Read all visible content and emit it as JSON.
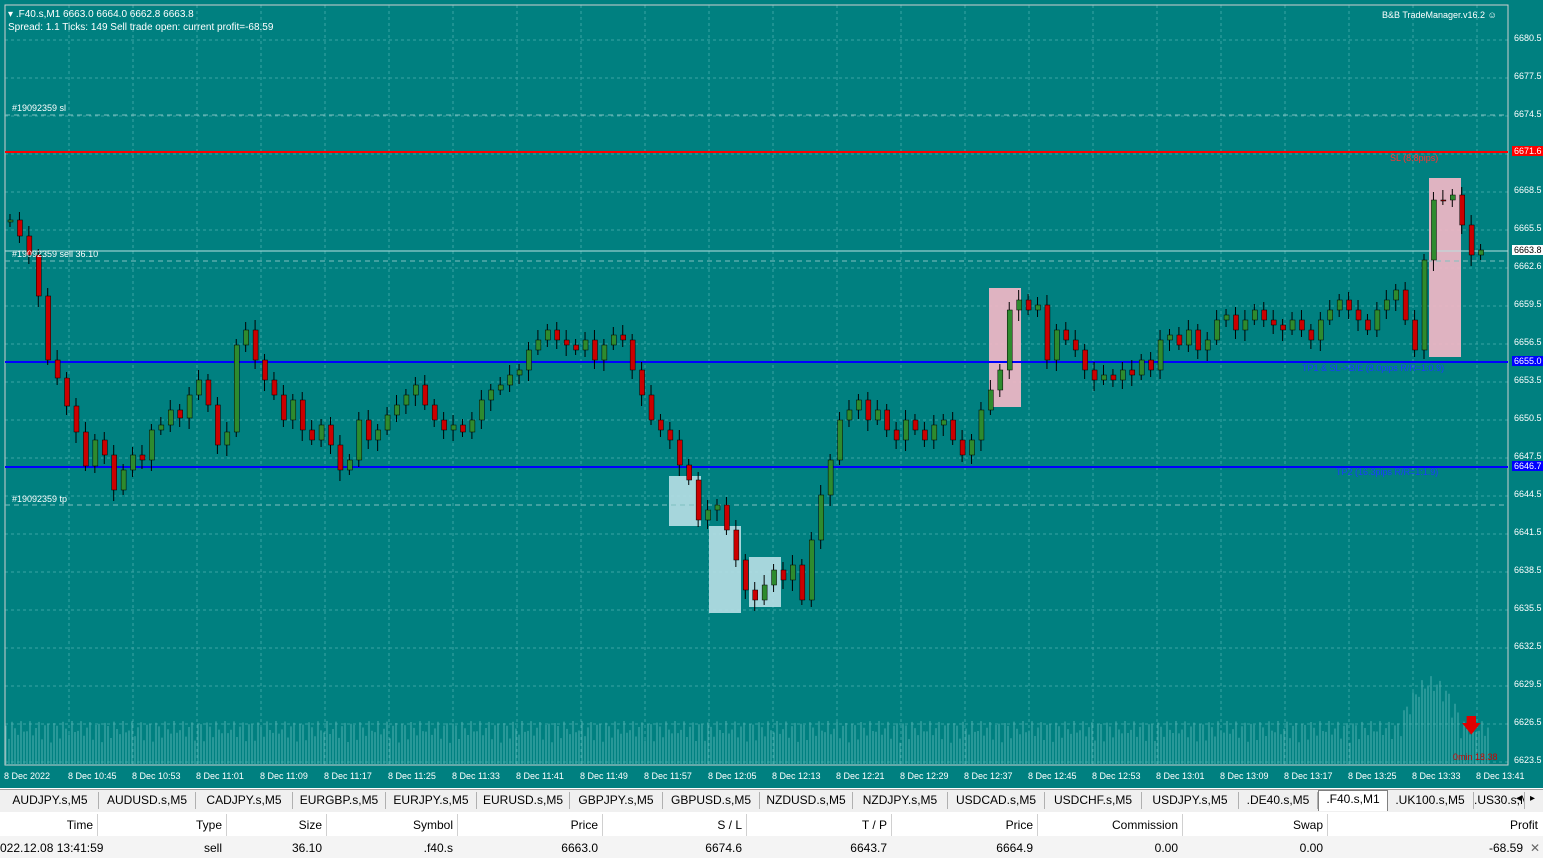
{
  "chart": {
    "header_line1": ".F40.s,M1  6663.0 6664.0 6662.8 6663.8",
    "header_line2": "Spread: 1.1   Ticks: 149   Sell trade open: current profit=-68.59",
    "indicator": "B&B TradeManager.v16.2",
    "lines": {
      "sl_label": "#19092359 sl",
      "entry_label": "#19092359 sell 36.10",
      "tp_label": "#19092359 tp",
      "sl_text": "SL (8.8pips)",
      "tp1_text": "TP1 & SL->B/E (8.0pips R/R=1:0.9)",
      "tp2_text": "TP2 (16.3pips R/R=1:1.9)",
      "timer": "0min 18.38"
    },
    "price_tags": {
      "sl": "6671.6",
      "current": "6663.8",
      "tp1": "6655.0",
      "tp2": "6646.7"
    },
    "price_axis": [
      "6680.5",
      "6677.5",
      "6674.5",
      "6671.5",
      "6668.5",
      "6665.5",
      "6662.6",
      "6659.5",
      "6656.5",
      "6653.5",
      "6650.5",
      "6647.5",
      "6644.5",
      "6641.5",
      "6638.5",
      "6635.5",
      "6632.5",
      "6629.5",
      "6626.5",
      "6623.5"
    ],
    "time_axis": [
      "8 Dec 2022",
      "8 Dec 10:45",
      "8 Dec 10:53",
      "8 Dec 11:01",
      "8 Dec 11:09",
      "8 Dec 11:17",
      "8 Dec 11:25",
      "8 Dec 11:33",
      "8 Dec 11:41",
      "8 Dec 11:49",
      "8 Dec 11:57",
      "8 Dec 12:05",
      "8 Dec 12:13",
      "8 Dec 12:21",
      "8 Dec 12:29",
      "8 Dec 12:37",
      "8 Dec 12:45",
      "8 Dec 12:53",
      "8 Dec 13:01",
      "8 Dec 13:09",
      "8 Dec 13:17",
      "8 Dec 13:25",
      "8 Dec 13:33",
      "8 Dec 13:41"
    ],
    "colors": {
      "background": "#008080",
      "bull": "#2e8b2e",
      "bear": "#cc0000",
      "sl_line": "#ff0000",
      "tp_line": "#0000ff"
    }
  },
  "tabs": [
    "AUDJPY.s,M5",
    "AUDUSD.s,M5",
    "CADJPY.s,M5",
    "EURGBP.s,M5",
    "EURJPY.s,M5",
    "EURUSD.s,M5",
    "GBPJPY.s,M5",
    "GBPUSD.s,M5",
    "NZDUSD.s,M5",
    "NZDJPY.s,M5",
    "USDCAD.s,M5",
    "USDCHF.s,M5",
    "USDJPY.s,M5",
    ".DE40.s,M5",
    ".F40.s,M1",
    ".UK100.s,M5",
    ".US30.s,M"
  ],
  "active_tab": ".F40.s,M1",
  "terminal": {
    "headers": [
      "Time",
      "Type",
      "Size",
      "Symbol",
      "Price",
      "S / L",
      "T / P",
      "Price",
      "Commission",
      "Swap",
      "Profit"
    ],
    "row": [
      "022.12.08 13:41:59",
      "sell",
      "36.10",
      ".f40.s",
      "6663.0",
      "6674.6",
      "6643.7",
      "6664.9",
      "0.00",
      "0.00",
      "-68.59"
    ]
  }
}
